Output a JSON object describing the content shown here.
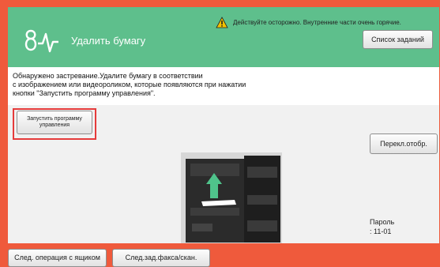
{
  "header": {
    "title": "Удалить бумагу",
    "logo_icon": "wavy-line-logo-icon",
    "accent_color": "#5ebf8c"
  },
  "warning": {
    "icon": "warning-triangle-icon",
    "text": "Действуйте осторожно. Внутренние части очень горячие."
  },
  "buttons": {
    "job_list": "Список заданий",
    "launch_guide": "Запустить программу\nуправления",
    "switch_display": "Перекл.отобр.",
    "mailbox_next": "След. операция с ящиком",
    "fax_scan_next": "След.зад.факса/скан."
  },
  "message": "Обнаружено застревание.Удалите бумагу в соответствии\nс изображением или видеороликом, которые появляются при нажатии\nкнопки \"Запустить программу управления\".",
  "status": {
    "password_label": "Пароль",
    "password_value": ": 11-01"
  },
  "colors": {
    "frame": "#ef5a3c",
    "highlight": "#e53b3b"
  }
}
